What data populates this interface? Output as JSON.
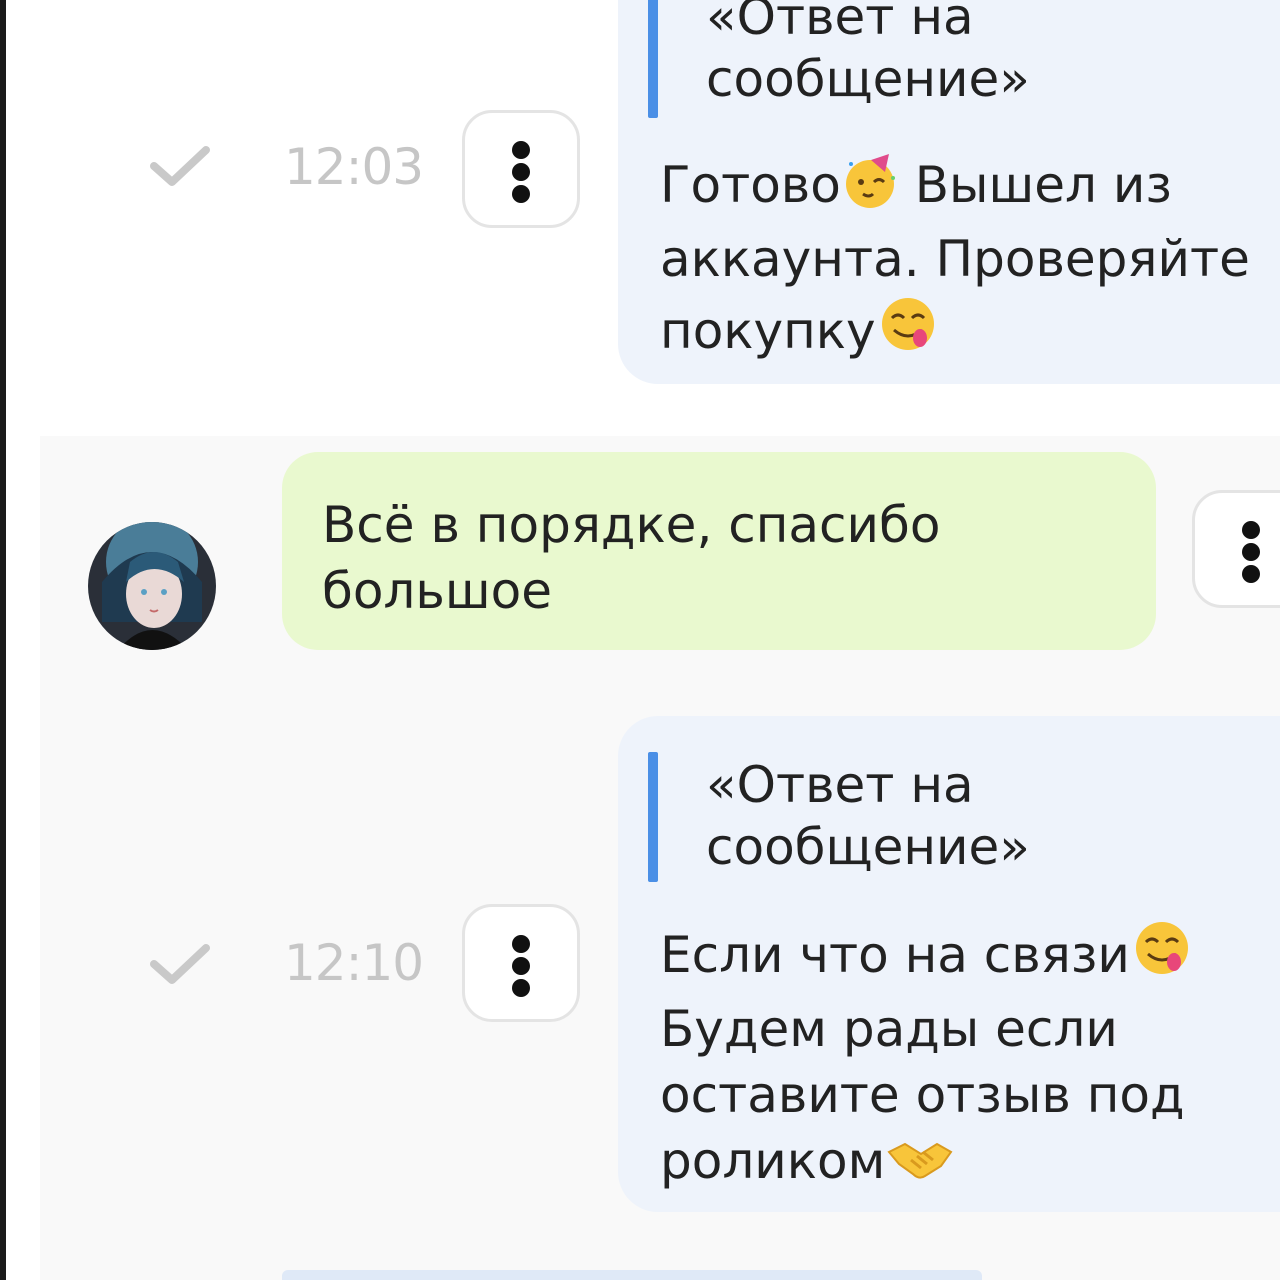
{
  "messages": [
    {
      "direction": "outgoing",
      "quote": "«Ответ на\nсообщение»",
      "text_before_emoji": "Готово",
      "emoji_1": "partying-face",
      "text_middle": " Вышел из аккаунта. Проверяйте покупку",
      "emoji_2": "face-savoring-food",
      "time": "12:03",
      "status": "sent"
    },
    {
      "direction": "incoming",
      "text": "Всё в порядке, спасибо большое"
    },
    {
      "direction": "outgoing",
      "quote": "«Ответ на\nсообщение»",
      "text_line_1": "Если что на связи",
      "emoji_1": "face-savoring-food",
      "text_rest": "Будем рады если оставите отзыв под роликом",
      "emoji_2": "handshake",
      "time": "12:10",
      "status": "sent"
    }
  ],
  "colors": {
    "outgoing_bubble": "#eef3fb",
    "incoming_bubble": "#e9f9cf",
    "quote_bar": "#4a8fe6",
    "time_text": "#c6c6c6",
    "check_mark": "#c9c9c9"
  }
}
